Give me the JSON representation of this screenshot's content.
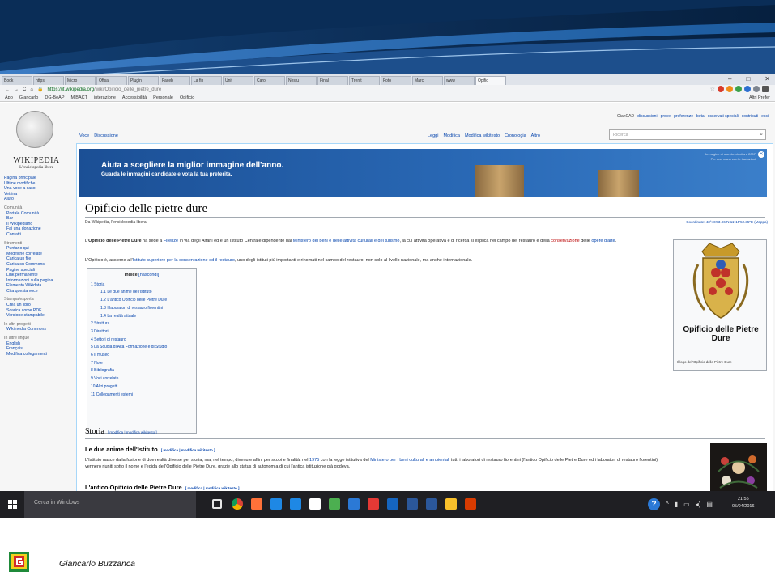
{
  "browser": {
    "tabs": [
      "Book",
      "https:",
      "Micro",
      "Offsa",
      "Plugin",
      "Faceb",
      "La fin",
      "Unit",
      "Caro",
      "Nestu",
      "Final",
      "Trenit",
      "Foto",
      "Marc",
      "www",
      "Opific"
    ],
    "window_controls": [
      "–",
      "□",
      "✕"
    ],
    "url_host": "https://it.wikipedia.org",
    "url_path": "/wiki/Opificio_delle_pietre_dure",
    "bookmarks": [
      "App",
      "Giancarlo",
      "DG-BeAP",
      "MiBACT",
      "interazione",
      "Accessibilità",
      "Personale",
      "Opificio"
    ],
    "bookmarks_right": "Altri Prefer"
  },
  "wiki": {
    "logo_text": "WIKIPEDIA",
    "logo_sub": "L'enciclopedia libera",
    "sidebar": [
      {
        "label": "Pagina principale",
        "kind": "item"
      },
      {
        "label": "Ultime modifiche",
        "kind": "item"
      },
      {
        "label": "Una voce a caso",
        "kind": "item"
      },
      {
        "label": "Vetrina",
        "kind": "item"
      },
      {
        "label": "Aiuto",
        "kind": "item"
      },
      {
        "label": "Comunità",
        "kind": "head"
      },
      {
        "label": "Portale Comunità",
        "kind": "sub"
      },
      {
        "label": "Bar",
        "kind": "sub"
      },
      {
        "label": "Il Wikipediano",
        "kind": "sub"
      },
      {
        "label": "Fai una donazione",
        "kind": "sub"
      },
      {
        "label": "Contatti",
        "kind": "sub"
      },
      {
        "label": "Strumenti",
        "kind": "head"
      },
      {
        "label": "Puntano qui",
        "kind": "sub"
      },
      {
        "label": "Modifiche correlate",
        "kind": "sub"
      },
      {
        "label": "Carica un file",
        "kind": "sub"
      },
      {
        "label": "Carica su Commons",
        "kind": "sub"
      },
      {
        "label": "Pagine speciali",
        "kind": "sub"
      },
      {
        "label": "Link permanente",
        "kind": "sub"
      },
      {
        "label": "Informazioni sulla pagina",
        "kind": "sub"
      },
      {
        "label": "Elemento Wikidata",
        "kind": "sub"
      },
      {
        "label": "Cita questa voce",
        "kind": "sub"
      },
      {
        "label": "Stampa/esporta",
        "kind": "head"
      },
      {
        "label": "Crea un libro",
        "kind": "sub"
      },
      {
        "label": "Scarica come PDF",
        "kind": "sub"
      },
      {
        "label": "Versione stampabile",
        "kind": "sub"
      },
      {
        "label": "In altri progetti",
        "kind": "head"
      },
      {
        "label": "Wikimedia Commons",
        "kind": "sub"
      },
      {
        "label": "In altre lingue",
        "kind": "head"
      },
      {
        "label": "English",
        "kind": "sub"
      },
      {
        "label": "Français",
        "kind": "sub"
      },
      {
        "label": "Modifica collegamenti",
        "kind": "sub"
      }
    ],
    "personal_user": "GianCAD",
    "personal_links": [
      "discussioni",
      "prove",
      "preferenze",
      "beta",
      "osservati speciali",
      "contributi",
      "esci"
    ],
    "tabs_left": [
      "Voce",
      "Discussione"
    ],
    "tabs_right": [
      "Leggi",
      "Modifica",
      "Modifica wikitesto",
      "Cronologia",
      "Altro"
    ],
    "search_placeholder": "Ricerca",
    "promo_title": "Aiuta a scegliere la miglior immagine dell'anno.",
    "promo_sub": "Guarda le immagini candidate e vota la tua preferita.",
    "promo_right_1": "Immagine di sfondo: vincitore 2007",
    "promo_right_2": "Per una mano con le traduzioni",
    "title": "Opificio delle pietre dure",
    "tagline": "Da Wikipedia, l'enciclopedia libera.",
    "coords": "Coordinate: 43°46'33.96\"N 11°15'52.35\"E (Mappa)",
    "para1_a": "L'",
    "para1_b": "Opificio delle Pietre Dure",
    "para1_c": " ha sede a ",
    "para1_d": "Firenze",
    "para1_e": " in via degli Alfani ed è un Istituto Centrale dipendente dal ",
    "para1_f": "Ministero dei beni e delle attività culturali e del turismo",
    "para1_g": ", la cui attività operativa e di ricerca si esplica nel campo del restauro e della ",
    "para1_h": "conservazione",
    "para1_i": " delle ",
    "para1_j": "opere d'arte",
    "para1_k": ".",
    "para2_a": "L'Opificio è, assieme all'",
    "para2_b": "Istituto superiore per la conservazione ed il restauro",
    "para2_c": ", uno degli istituti più importanti e rinomati nel campo del restauro, non solo al livello nazionale, ma anche internazionale.",
    "toc_title": "Indice",
    "toc_hide": "[nascondi]",
    "toc": [
      {
        "label": "1 Storia",
        "level": 1
      },
      {
        "label": "1.1 Le due anime dell'Istituto",
        "level": 2
      },
      {
        "label": "1.2 L'antico Opificio delle Pietre Dure",
        "level": 2
      },
      {
        "label": "1.3 I laboratori di restauro fiorentini",
        "level": 2
      },
      {
        "label": "1.4 La realtà attuale",
        "level": 2
      },
      {
        "label": "2 Struttura",
        "level": 1
      },
      {
        "label": "3 Direttori",
        "level": 1
      },
      {
        "label": "4 Settori di restauro",
        "level": 1
      },
      {
        "label": "5 La Scuola di Alta Formazione e di Studio",
        "level": 1
      },
      {
        "label": "6 Il museo",
        "level": 1
      },
      {
        "label": "7 Note",
        "level": 1
      },
      {
        "label": "8 Bibliografia",
        "level": 1
      },
      {
        "label": "9 Voci correlate",
        "level": 1
      },
      {
        "label": "10 Altri progetti",
        "level": 1
      },
      {
        "label": "11 Collegamenti esterni",
        "level": 1
      }
    ],
    "infobox_name": "Opificio delle Pietre Dure",
    "infobox_caption": "Il logo dell'Opificio delle Pietre Dure",
    "h2_storia": "Storia",
    "h2_edit": "[ modifica | modifica wikitesto ]",
    "h3_anime": "Le due anime dell'Istituto",
    "h3_edit": "[ modifica | modifica wikitesto ]",
    "storia_p1_a": "L'Istituto nasce dalla fusione di due realtà diverse per storia, ma, nel tempo, divenute affini per scopi e finalità: nel ",
    "storia_p1_b": "1975",
    "storia_p1_c": " con la legge istitutiva del ",
    "storia_p1_d": "Ministero per i beni culturali e ambientali",
    "storia_p1_e": " tutti i laboratori di restauro fiorentini",
    "storia_p2": "(l'antico Opificio delle Pietre Dure ed i laboratori di restauro fiorentini) vennero riuniti sotto il nome e l'egida dell'Opificio delle Pietre Dure, grazie allo status di autonomia di cui l'antica istituzione già godeva.",
    "h3_antico": "L'antico Opificio delle Pietre Dure",
    "h3_antico_edit": "[ modifica | modifica wikitesto ]"
  },
  "taskbar": {
    "search_placeholder": "Cerca in Windows",
    "time": "21:55",
    "date": "05/04/2016"
  },
  "footer": {
    "author": "Giancarlo Buzzanca"
  },
  "colors": {
    "banner_dark": "#0b2b52",
    "banner_mid": "#2a6ab7",
    "wiki_link": "#0645ad",
    "taskbar": "#1f1f23"
  }
}
